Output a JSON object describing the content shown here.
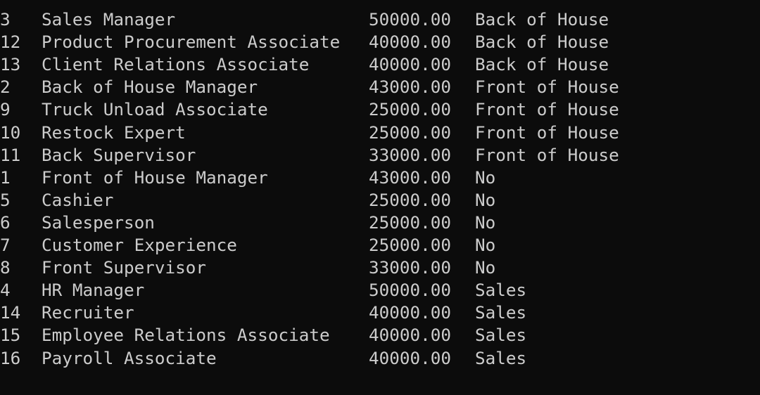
{
  "colors": {
    "background": "#0c0c0c",
    "text": "#cccccc"
  },
  "separator": {
    "id": "--",
    "name": "-----------------------------",
    "salary": "--------",
    "dept": "--------------"
  },
  "rows": [
    {
      "id": "3",
      "name": "Sales Manager",
      "salary": "50000.00",
      "dept": "Back of House"
    },
    {
      "id": "12",
      "name": "Product Procurement Associate",
      "salary": "40000.00",
      "dept": "Back of House"
    },
    {
      "id": "13",
      "name": "Client Relations Associate",
      "salary": "40000.00",
      "dept": "Back of House"
    },
    {
      "id": "2",
      "name": "Back of House Manager",
      "salary": "43000.00",
      "dept": "Front of House"
    },
    {
      "id": "9",
      "name": "Truck Unload Associate",
      "salary": "25000.00",
      "dept": "Front of House"
    },
    {
      "id": "10",
      "name": "Restock Expert",
      "salary": "25000.00",
      "dept": "Front of House"
    },
    {
      "id": "11",
      "name": "Back Supervisor",
      "salary": "33000.00",
      "dept": "Front of House"
    },
    {
      "id": "1",
      "name": "Front of House Manager",
      "salary": "43000.00",
      "dept": "No"
    },
    {
      "id": "5",
      "name": "Cashier",
      "salary": "25000.00",
      "dept": "No"
    },
    {
      "id": "6",
      "name": "Salesperson",
      "salary": "25000.00",
      "dept": "No"
    },
    {
      "id": "7",
      "name": "Customer Experience",
      "salary": "25000.00",
      "dept": "No"
    },
    {
      "id": "8",
      "name": "Front Supervisor",
      "salary": "33000.00",
      "dept": "No"
    },
    {
      "id": "4",
      "name": "HR Manager",
      "salary": "50000.00",
      "dept": "Sales"
    },
    {
      "id": "14",
      "name": "Recruiter",
      "salary": "40000.00",
      "dept": "Sales"
    },
    {
      "id": "15",
      "name": "Employee Relations Associate",
      "salary": "40000.00",
      "dept": "Sales"
    },
    {
      "id": "16",
      "name": "Payroll Associate",
      "salary": "40000.00",
      "dept": "Sales"
    }
  ]
}
